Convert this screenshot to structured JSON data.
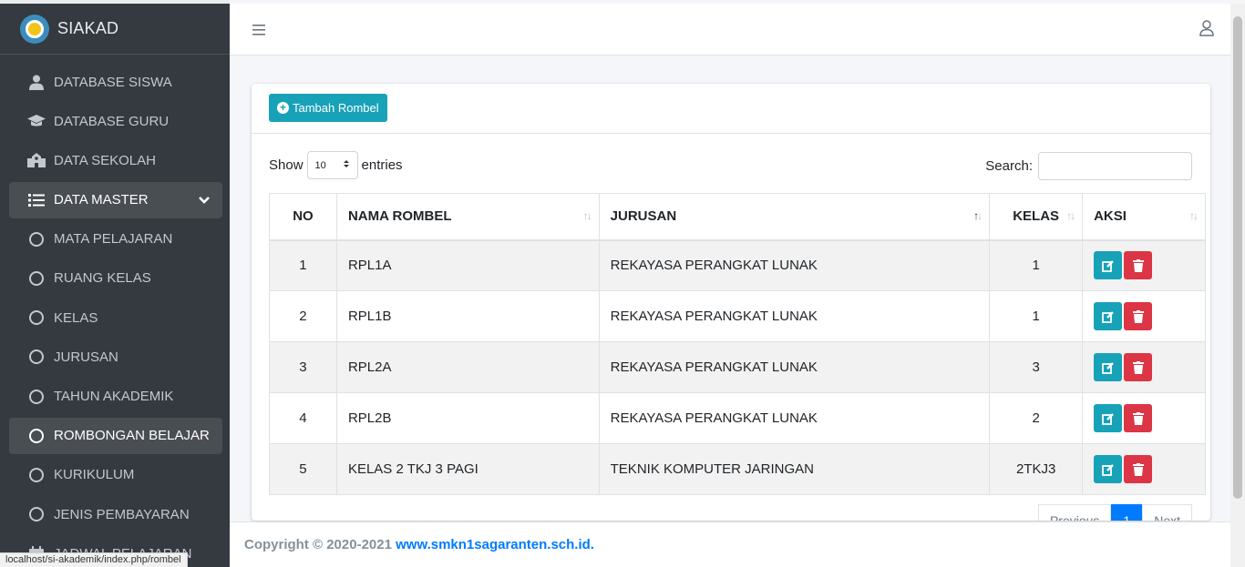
{
  "brand": {
    "title": "SIAKAD"
  },
  "sidebar": {
    "items": [
      {
        "label": "DATABASE SISWA",
        "icon": "user-icon"
      },
      {
        "label": "DATABASE GURU",
        "icon": "graduation-cap-icon"
      },
      {
        "label": "DATA SEKOLAH",
        "icon": "school-icon"
      },
      {
        "label": "DATA MASTER",
        "icon": "list-icon",
        "expanded": true
      },
      {
        "label": "MATA PELAJARAN",
        "icon": "circle-icon"
      },
      {
        "label": "RUANG KELAS",
        "icon": "circle-icon"
      },
      {
        "label": "KELAS",
        "icon": "circle-icon"
      },
      {
        "label": "JURUSAN",
        "icon": "circle-icon"
      },
      {
        "label": "TAHUN AKADEMIK",
        "icon": "circle-icon"
      },
      {
        "label": "ROMBONGAN BELAJAR",
        "icon": "circle-icon",
        "active": true
      },
      {
        "label": "KURIKULUM",
        "icon": "circle-icon"
      },
      {
        "label": "JENIS PEMBAYARAN",
        "icon": "circle-icon"
      },
      {
        "label": "JADWAL PELAJARAN",
        "icon": "calendar-icon"
      }
    ]
  },
  "status_url": "localhost/si-akademik/index.php/rombel",
  "card": {
    "add_button": "Tambah Rombel",
    "show_label": "Show",
    "entries_value": "10",
    "entries_label": "entries",
    "search_label": "Search:",
    "search_value": ""
  },
  "table": {
    "headers": [
      "NO",
      "NAMA ROMBEL",
      "JURUSAN",
      "KELAS",
      "AKSI"
    ],
    "rows": [
      {
        "no": "1",
        "nama": "RPL1A",
        "jurusan": "REKAYASA PERANGKAT LUNAK",
        "kelas": "1"
      },
      {
        "no": "2",
        "nama": "RPL1B",
        "jurusan": "REKAYASA PERANGKAT LUNAK",
        "kelas": "1"
      },
      {
        "no": "3",
        "nama": "RPL2A",
        "jurusan": "REKAYASA PERANGKAT LUNAK",
        "kelas": "3"
      },
      {
        "no": "4",
        "nama": "RPL2B",
        "jurusan": "REKAYASA PERANGKAT LUNAK",
        "kelas": "2"
      },
      {
        "no": "5",
        "nama": "KELAS 2 TKJ 3 PAGI",
        "jurusan": "TEKNIK KOMPUTER JARINGAN",
        "kelas": "2TKJ3"
      }
    ]
  },
  "pagination": {
    "previous": "Previous",
    "current": "1",
    "next": "Next"
  },
  "footer": {
    "copyright": "Copyright © 2020-2021",
    "link": "www.smkn1sagaranten.sch.id."
  },
  "colors": {
    "sidebar": "#343a40",
    "info": "#17a2b8",
    "danger": "#dc3545",
    "primary": "#007bff"
  }
}
